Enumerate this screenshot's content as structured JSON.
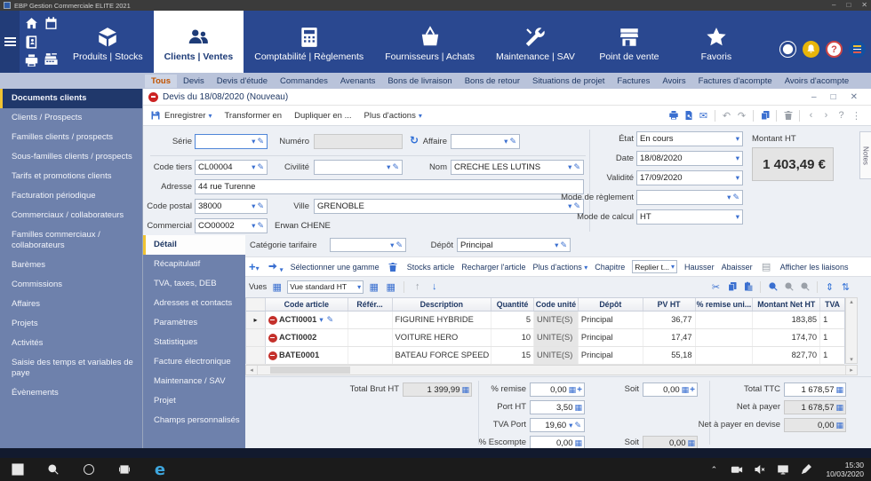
{
  "titlebar": {
    "title": "EBP Gestion Commerciale ELITE 2021",
    "controls": {
      "minimize": "–",
      "maximize": "□",
      "close": "✕"
    }
  },
  "nav": {
    "modules": [
      {
        "label": "Produits | Stocks",
        "icon": "products-box",
        "active": false
      },
      {
        "label": "Clients | Ventes",
        "icon": "clients-people",
        "active": true
      },
      {
        "label": "Comptabilité | Règlements",
        "icon": "accounting-calculator",
        "active": false
      },
      {
        "label": "Fournisseurs | Achats",
        "icon": "suppliers-basket",
        "active": false
      },
      {
        "label": "Maintenance | SAV",
        "icon": "maintenance-tools",
        "active": false
      },
      {
        "label": "Point de vente",
        "icon": "pos-store",
        "active": false
      },
      {
        "label": "Favoris",
        "icon": "favorites-star",
        "active": false
      }
    ]
  },
  "doc_tabs": {
    "items": [
      {
        "label": "Tous",
        "active": true
      },
      {
        "label": "Devis",
        "active": false
      },
      {
        "label": "Devis d'étude",
        "active": false
      },
      {
        "label": "Commandes",
        "active": false
      },
      {
        "label": "Avenants",
        "active": false
      },
      {
        "label": "Bons de livraison",
        "active": false
      },
      {
        "label": "Bons de retour",
        "active": false
      },
      {
        "label": "Situations de projet",
        "active": false
      },
      {
        "label": "Factures",
        "active": false
      },
      {
        "label": "Avoirs",
        "active": false
      },
      {
        "label": "Factures d'acompte",
        "active": false
      },
      {
        "label": "Avoirs d'acompte",
        "active": false
      }
    ]
  },
  "sidebar": {
    "items": [
      {
        "label": "Documents clients",
        "active": true
      },
      {
        "label": "Clients / Prospects",
        "active": false
      },
      {
        "label": "Familles clients / prospects",
        "active": false
      },
      {
        "label": "Sous-familles clients / prospects",
        "active": false
      },
      {
        "label": "Tarifs et promotions clients",
        "active": false
      },
      {
        "label": "Facturation périodique",
        "active": false
      },
      {
        "label": "Commerciaux / collaborateurs",
        "active": false
      },
      {
        "label": "Familles commerciaux / collaborateurs",
        "active": false
      },
      {
        "label": "Barèmes",
        "active": false
      },
      {
        "label": "Commissions",
        "active": false
      },
      {
        "label": "Affaires",
        "active": false
      },
      {
        "label": "Projets",
        "active": false
      },
      {
        "label": "Activités",
        "active": false
      },
      {
        "label": "Saisie des temps et variables de paye",
        "active": false
      },
      {
        "label": "Évènements",
        "active": false
      }
    ]
  },
  "document": {
    "title": "Devis du 18/08/2020 (Nouveau)",
    "toolbar": {
      "save": "Enregistrer",
      "transform": "Transformer en",
      "duplicate": "Dupliquer en ...",
      "more_actions": "Plus d'actions"
    },
    "fields": {
      "serie": {
        "label": "Série",
        "value": ""
      },
      "numero": {
        "label": "Numéro",
        "value": ""
      },
      "affaire": {
        "label": "Affaire",
        "value": ""
      },
      "code_tiers": {
        "label": "Code tiers",
        "value": "CL00004"
      },
      "civilite": {
        "label": "Civilité",
        "value": ""
      },
      "nom": {
        "label": "Nom",
        "value": "CRECHE LES LUTINS"
      },
      "adresse": {
        "label": "Adresse",
        "value": "44 rue Turenne"
      },
      "code_postal": {
        "label": "Code postal",
        "value": "38000"
      },
      "ville": {
        "label": "Ville",
        "value": "GRENOBLE"
      },
      "commercial": {
        "label": "Commercial",
        "value": "CO00002",
        "display": "Erwan CHENE"
      },
      "etat": {
        "label": "État",
        "value": "En cours"
      },
      "date": {
        "label": "Date",
        "value": "18/08/2020"
      },
      "validite": {
        "label": "Validité",
        "value": "17/09/2020"
      },
      "mode_reglement": {
        "label": "Mode de règlement",
        "value": ""
      },
      "mode_calcul": {
        "label": "Mode de calcul",
        "value": "HT"
      },
      "montant_ht": {
        "label": "Montant HT",
        "value": "1 403,49 €"
      }
    },
    "notes_tab": "Notes",
    "detail_tabs": {
      "items": [
        {
          "label": "Détail",
          "active": true
        },
        {
          "label": "Récapitulatif",
          "active": false
        },
        {
          "label": "TVA, taxes, DEB",
          "active": false
        },
        {
          "label": "Adresses et contacts",
          "active": false
        },
        {
          "label": "Paramètres",
          "active": false
        },
        {
          "label": "Statistiques",
          "active": false
        },
        {
          "label": "Facture électronique",
          "active": false
        },
        {
          "label": "Maintenance / SAV",
          "active": false
        },
        {
          "label": "Projet",
          "active": false
        },
        {
          "label": "Champs personnalisés",
          "active": false
        }
      ]
    },
    "detail": {
      "categorie_tarifaire": {
        "label": "Catégorie tarifaire",
        "value": ""
      },
      "depot": {
        "label": "Dépôt",
        "value": "Principal"
      },
      "toolbar": {
        "select_gamme": "Sélectionner une gamme",
        "stocks_article": "Stocks article",
        "recharger_article": "Recharger l'article",
        "plus_actions": "Plus d'actions",
        "chapitre": "Chapitre",
        "replier": "Replier t...",
        "hausser": "Hausser",
        "abaisser": "Abaisser",
        "afficher_liaisons": "Afficher les liaisons"
      },
      "views": {
        "label": "Vues",
        "selected": "Vue standard HT"
      },
      "table": {
        "headers": [
          "Code article",
          "Référ...",
          "Description",
          "Quantité",
          "Code unité",
          "Dépôt",
          "PV HT",
          "% remise uni...",
          "Montant Net HT",
          "TVA"
        ],
        "rows": [
          {
            "code": "ACTI0001",
            "ref": "",
            "description": "FIGURINE HYBRIDE",
            "quantite": "5",
            "unite": "UNITE(S)",
            "depot": "Principal",
            "pv_ht": "36,77",
            "remise": "",
            "montant_net_ht": "183,85",
            "tva": "1",
            "active": true
          },
          {
            "code": "ACTI0002",
            "ref": "",
            "description": "VOITURE HERO",
            "quantite": "10",
            "unite": "UNITE(S)",
            "depot": "Principal",
            "pv_ht": "17,47",
            "remise": "",
            "montant_net_ht": "174,70",
            "tva": "1",
            "active": false
          },
          {
            "code": "BATE0001",
            "ref": "",
            "description": "BATEAU FORCE SPEED",
            "quantite": "15",
            "unite": "UNITE(S)",
            "depot": "Principal",
            "pv_ht": "55,18",
            "remise": "",
            "montant_net_ht": "827,70",
            "tva": "1",
            "active": false
          }
        ]
      },
      "totals": {
        "total_brut_ht": {
          "label": "Total Brut HT",
          "value": "1 399,99"
        },
        "pct_remise": {
          "label": "% remise",
          "value": "0,00"
        },
        "soit_remise": {
          "label": "Soit",
          "value": "0,00"
        },
        "port_ht": {
          "label": "Port HT",
          "value": "3,50"
        },
        "tva_port": {
          "label": "TVA Port",
          "value": "19,60"
        },
        "pct_escompte": {
          "label": "% Escompte",
          "value": "0,00"
        },
        "soit_escompte": {
          "label": "Soit",
          "value": "0,00"
        },
        "total_ttc": {
          "label": "Total TTC",
          "value": "1 678,57"
        },
        "net_a_payer": {
          "label": "Net à payer",
          "value": "1 678,57"
        },
        "net_a_payer_devise": {
          "label": "Net à payer en devise",
          "value": "0,00"
        }
      }
    }
  },
  "taskbar": {
    "time": "15:30",
    "date": "10/03/2020"
  }
}
